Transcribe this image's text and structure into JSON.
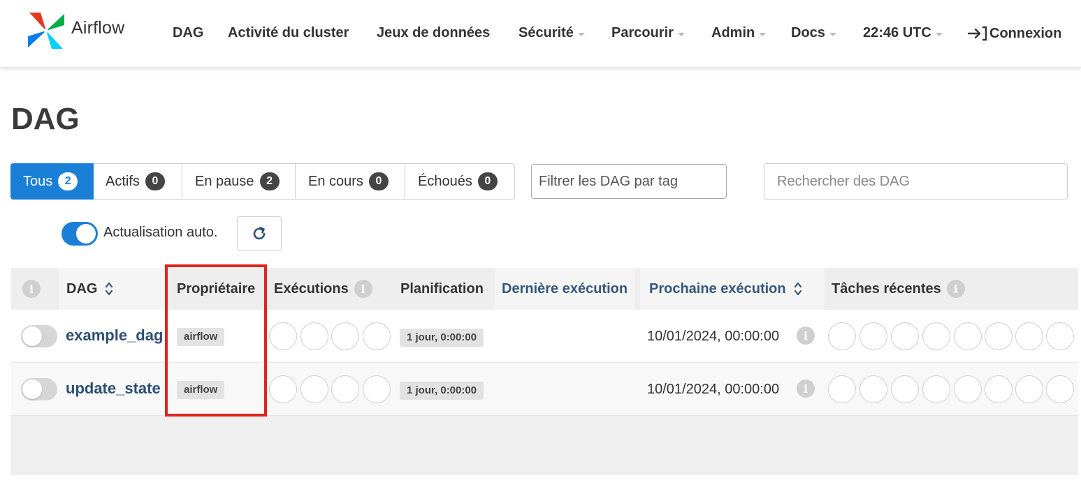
{
  "navbar": {
    "brand": "Airflow",
    "items": {
      "dag": "DAG",
      "cluster": "Activité du cluster",
      "datasets": "Jeux de données",
      "security": "Sécurité",
      "browse": "Parcourir",
      "admin": "Admin",
      "docs": "Docs",
      "time": "22:46 UTC",
      "login": "Connexion"
    }
  },
  "page": {
    "title": "DAG"
  },
  "filters": {
    "all": {
      "label": "Tous",
      "count": "2"
    },
    "active": {
      "label": "Actifs",
      "count": "0"
    },
    "paused": {
      "label": "En pause",
      "count": "2"
    },
    "running": {
      "label": "En cours",
      "count": "0"
    },
    "failed": {
      "label": "Échoués",
      "count": "0"
    },
    "tag_placeholder": "Filtrer les DAG par tag",
    "search_placeholder": "Rechercher des DAG"
  },
  "autorefresh": {
    "label": "Actualisation auto."
  },
  "table": {
    "headers": {
      "info": "i",
      "dag": "DAG",
      "owner": "Propriétaire",
      "runs": "Exécutions",
      "schedule": "Planification",
      "last_run": "Dernière exécution",
      "next_run": "Prochaine exécution",
      "recent_tasks": "Tâches récentes"
    },
    "rows": [
      {
        "dag_id": "example_dag",
        "owner": "airflow",
        "schedule": "1 jour, 0:00:00",
        "next_run": "10/01/2024, 00:00:00"
      },
      {
        "dag_id": "update_state",
        "owner": "airflow",
        "schedule": "1 jour, 0:00:00",
        "next_run": "10/01/2024, 00:00:00"
      }
    ]
  },
  "colors": {
    "accent": "#1a7fd6",
    "link": "#2d4f73",
    "highlight": "#e0241b"
  }
}
